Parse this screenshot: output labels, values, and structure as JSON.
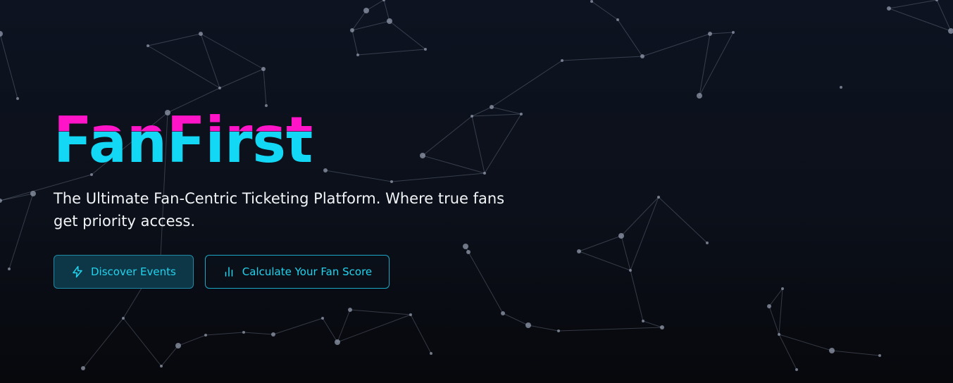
{
  "hero": {
    "brand": "FanFirst",
    "tagline": "The Ultimate Fan-Centric Ticketing Platform. Where true fans get priority access.",
    "buttons": {
      "discover": "Discover Events",
      "fan_score": "Calculate Your Fan Score"
    }
  },
  "icons": {
    "discover": "lightning-icon",
    "fan_score": "bar-chart-icon"
  },
  "colors": {
    "brand_cyan": "#12d8f5",
    "brand_magenta": "#ff14c8",
    "accent": "#22d3ee",
    "background": "#0b101a"
  }
}
